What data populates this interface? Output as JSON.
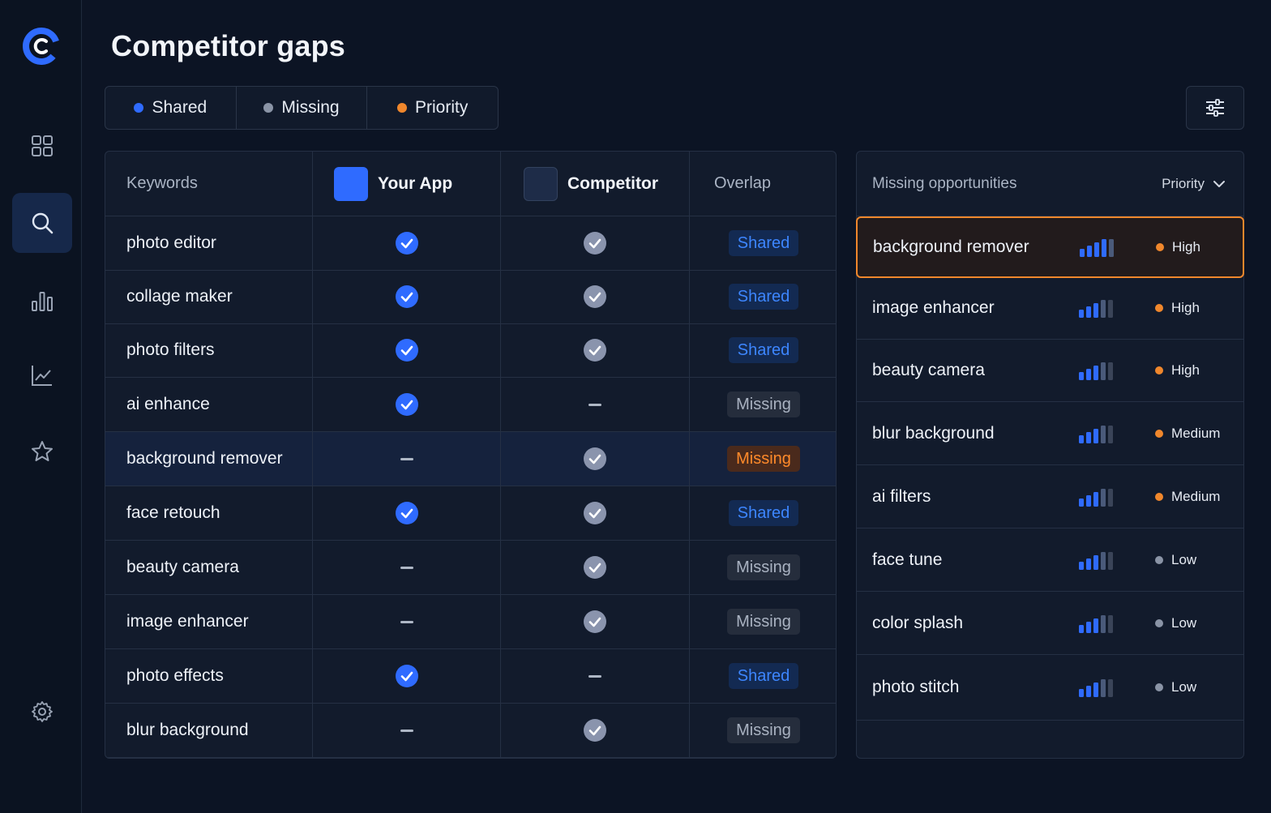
{
  "page": {
    "title": "Competitor gaps"
  },
  "colors": {
    "accent": "#2f6bff",
    "priority": "#f0872c",
    "muted": "#8a94a6",
    "competitor_icon": "#1e2c48"
  },
  "sidebar": {
    "logo_icon": "brand-logo-icon",
    "items": [
      {
        "name": "dashboard",
        "icon": "grid-icon",
        "active": false
      },
      {
        "name": "search",
        "icon": "search-icon",
        "active": true
      },
      {
        "name": "bar-chart",
        "icon": "bar-chart-icon",
        "active": false
      },
      {
        "name": "trends",
        "icon": "line-chart-icon",
        "active": false
      },
      {
        "name": "favorites",
        "icon": "star-icon",
        "active": false
      }
    ],
    "settings_icon": "gear-icon"
  },
  "legend": [
    {
      "label": "Shared",
      "color": "#2f6bff"
    },
    {
      "label": "Missing",
      "color": "#8a94a6"
    },
    {
      "label": "Priority",
      "color": "#f0872c"
    }
  ],
  "table": {
    "headers": {
      "keywords": "Keywords",
      "your_app": "Your App",
      "competitor": "Competitor",
      "overlap": "Overlap"
    },
    "rows": [
      {
        "keyword": "photo editor",
        "your_app": true,
        "competitor": true,
        "overlap": "Shared",
        "status": "shared"
      },
      {
        "keyword": "collage maker",
        "your_app": true,
        "competitor": true,
        "overlap": "Shared",
        "status": "shared"
      },
      {
        "keyword": "photo filters",
        "your_app": true,
        "competitor": true,
        "overlap": "Shared",
        "status": "shared"
      },
      {
        "keyword": "ai enhance",
        "your_app": true,
        "competitor": false,
        "overlap": "Missing",
        "status": "missing"
      },
      {
        "keyword": "background remover",
        "your_app": false,
        "competitor": true,
        "overlap": "Missing",
        "status": "priority",
        "highlight": true
      },
      {
        "keyword": "face retouch",
        "your_app": true,
        "competitor": true,
        "overlap": "Shared",
        "status": "shared"
      },
      {
        "keyword": "beauty camera",
        "your_app": false,
        "competitor": true,
        "overlap": "Missing",
        "status": "missing"
      },
      {
        "keyword": "image enhancer",
        "your_app": false,
        "competitor": true,
        "overlap": "Missing",
        "status": "missing"
      },
      {
        "keyword": "photo effects",
        "your_app": true,
        "competitor": false,
        "overlap": "Shared",
        "status": "shared"
      },
      {
        "keyword": "blur background",
        "your_app": false,
        "competitor": true,
        "overlap": "Missing",
        "status": "missing"
      }
    ]
  },
  "opportunities": {
    "title": "Missing opportunities",
    "sort_label": "Priority",
    "items": [
      {
        "keyword": "background remover",
        "strength": 4,
        "priority": "High",
        "level": "high",
        "selected": true
      },
      {
        "keyword": "image enhancer",
        "strength": 3,
        "priority": "High",
        "level": "high"
      },
      {
        "keyword": "beauty camera",
        "strength": 3,
        "priority": "High",
        "level": "high"
      },
      {
        "keyword": "blur background",
        "strength": 3,
        "priority": "Medium",
        "level": "medium"
      },
      {
        "keyword": "ai filters",
        "strength": 3,
        "priority": "Medium",
        "level": "medium"
      },
      {
        "keyword": "face tune",
        "strength": 3,
        "priority": "Low",
        "level": "low"
      },
      {
        "keyword": "color splash",
        "strength": 3,
        "priority": "Low",
        "level": "low"
      },
      {
        "keyword": "photo stitch",
        "strength": 3,
        "priority": "Low",
        "level": "low"
      }
    ]
  }
}
